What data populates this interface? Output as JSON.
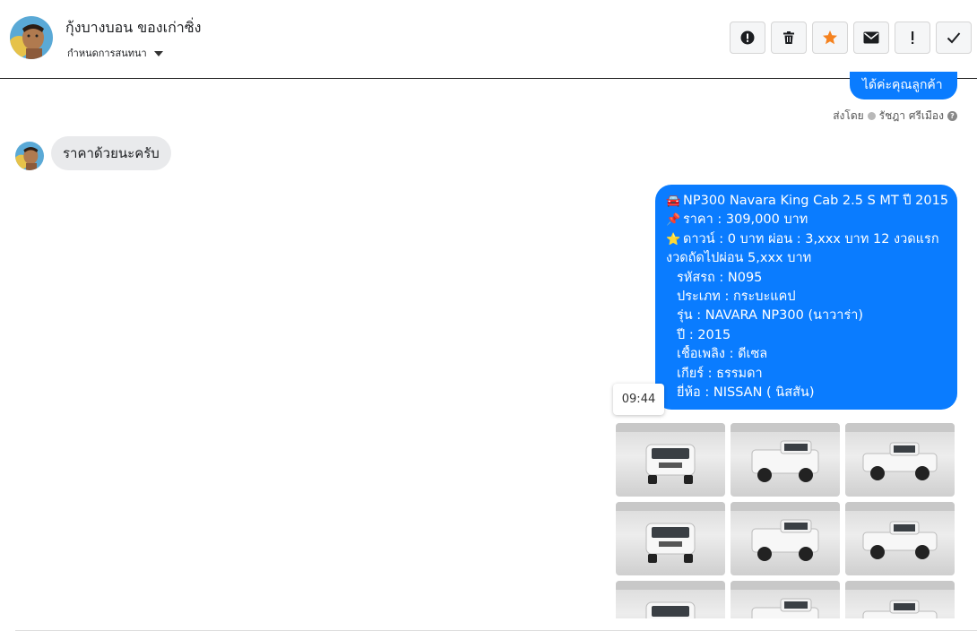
{
  "contact": {
    "name": "กุ้งบางบอน ของเก่าซิ่ง",
    "assign_label": "กำหนดการสนทนา"
  },
  "toolbar": {
    "buttons": [
      {
        "name": "report-spam-button",
        "icon": "alert-circle-icon"
      },
      {
        "name": "delete-button",
        "icon": "trash-icon"
      },
      {
        "name": "star-button",
        "icon": "star-icon",
        "color": "#f5821f"
      },
      {
        "name": "mark-unread-button",
        "icon": "envelope-icon"
      },
      {
        "name": "follow-up-button",
        "icon": "exclamation-icon"
      },
      {
        "name": "mark-done-button",
        "icon": "check-icon"
      }
    ]
  },
  "messages": {
    "outgoing_top": "ได้ค่ะคุณลูกค้า",
    "sent_by_label": "ส่งโดย",
    "sent_by_name": "รัชฎา ศรีเมือง",
    "help_icon": "?",
    "incoming": "ราคาด้วยนะครับ",
    "outgoing_lines": [
      {
        "emoji": "🚘",
        "text": "NP300 Navara King Cab 2.5 S MT ปี 2015"
      },
      {
        "emoji": "📌",
        "text": "ราคา : 309,000 บาท"
      },
      {
        "emoji": "⭐",
        "text": "ดาวน์ : 0 บาท ผ่อน : 3,xxx บาท 12 งวดแรก"
      },
      {
        "emoji": "",
        "text": "งวดถัดไปผ่อน  5,xxx บาท"
      },
      {
        "emoji": "",
        "text": "รหัสรถ : N095",
        "indent": true
      },
      {
        "emoji": "",
        "text": "ประเภท : กระบะแคป",
        "indent": true
      },
      {
        "emoji": "",
        "text": "รุ่น : NAVARA NP300 (นาวาร่า)",
        "indent": true
      },
      {
        "emoji": "",
        "text": "ปี : 2015",
        "indent": true
      },
      {
        "emoji": "",
        "text": "เชื้อเพลิง : ดีเซล",
        "indent": true
      },
      {
        "emoji": "",
        "text": "เกียร์ : ธรรมดา",
        "indent": true
      },
      {
        "emoji": "",
        "text": "ยี่ห้อ : NISSAN ( นิสสัน)",
        "indent": true
      }
    ],
    "timestamp": "09:44",
    "photos": [
      {
        "name": "truck-front-photo"
      },
      {
        "name": "truck-rear-quarter-photo"
      },
      {
        "name": "truck-rear-photo"
      },
      {
        "name": "truck-rear-left-photo"
      },
      {
        "name": "truck-front-right-photo"
      },
      {
        "name": "truck-side-photo"
      },
      {
        "name": "truck-side-top-photo"
      },
      {
        "name": "truck-wheel-photo"
      },
      {
        "name": "truck-interior-photo"
      }
    ]
  },
  "colors": {
    "accent_blue": "#0a7cff",
    "incoming_bubble": "#e9eaec",
    "star": "#f5821f"
  }
}
